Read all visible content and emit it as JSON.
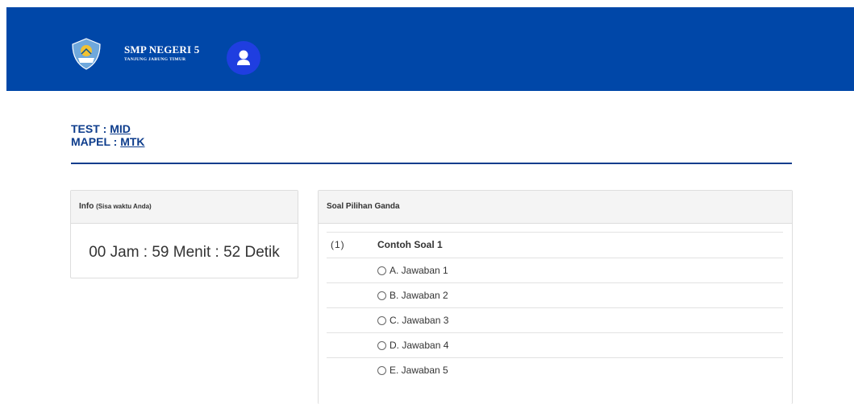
{
  "header": {
    "school_name": "SMP NEGERI 5",
    "school_sub": "TANJUNG JABUNG TIMUR",
    "logo_icon": "school-logo-icon",
    "user_icon": "user-icon",
    "colors": {
      "bar": "#0047a8",
      "avatar": "#1f3ee0"
    }
  },
  "meta": {
    "test_label": "TEST : ",
    "test_value": "MID",
    "mapel_label": "MAPEL : ",
    "mapel_value": "MTK"
  },
  "info_panel": {
    "title": "Info ",
    "title_note": "(Sisa waktu Anda)",
    "timer": "00 Jam : 59 Menit : 52 Detik"
  },
  "quiz_panel": {
    "title": "Soal Pilihan Ganda",
    "question": {
      "number": "(1)",
      "text": "Contoh Soal 1"
    },
    "options": [
      "A. Jawaban 1",
      "B. Jawaban 2",
      "C. Jawaban 3",
      "D. Jawaban 4",
      "E. Jawaban 5"
    ]
  }
}
